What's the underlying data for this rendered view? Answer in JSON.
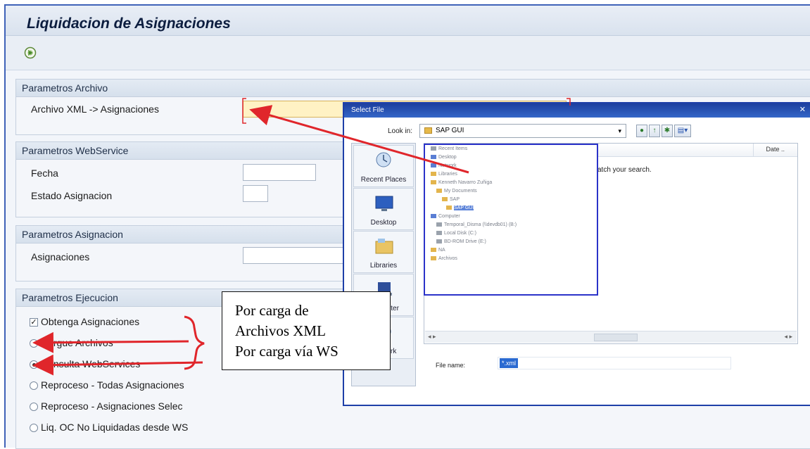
{
  "window": {
    "title": "Liquidacion de Asignaciones"
  },
  "toolbar": {
    "execute_icon": "execute-icon"
  },
  "groups": {
    "archivo": {
      "title": "Parametros Archivo",
      "field_label": "Archivo XML -> Asignaciones",
      "field_value": ""
    },
    "webservice": {
      "title": "Parametros WebService",
      "fecha_label": "Fecha",
      "fecha_value": "",
      "estado_label": "Estado Asignacion",
      "estado_value": ""
    },
    "asignacion": {
      "title": "Parametros Asignacion",
      "asignaciones_label": "Asignaciones",
      "asignaciones_value": ""
    },
    "ejecucion": {
      "title": "Parametros Ejecucion",
      "checkbox_label": "Obtenga Asignaciones",
      "checkbox_checked": true,
      "options": [
        {
          "label": "Cargue Archivos",
          "selected": false
        },
        {
          "label": "Consulta WebServices",
          "selected": true
        },
        {
          "label": "Reproceso - Todas Asignaciones",
          "selected": false
        },
        {
          "label": "Reproceso - Asignaciones Selec",
          "selected": false
        },
        {
          "label": "Liq. OC No Liquidadas desde WS",
          "selected": false
        }
      ]
    }
  },
  "dialog": {
    "title": "Select File",
    "look_in_label": "Look in:",
    "look_in_value": "SAP GUI",
    "places": [
      {
        "label": "Recent Places",
        "icon": "recent-places-icon"
      },
      {
        "label": "Desktop",
        "icon": "desktop-icon"
      },
      {
        "label": "Libraries",
        "icon": "libraries-icon"
      },
      {
        "label": "Computer",
        "icon": "computer-icon"
      },
      {
        "label": "Network",
        "icon": "network-icon"
      }
    ],
    "column_date": "Date ..",
    "empty_message": "atch your search.",
    "file_name_label": "File name:",
    "file_name_value": "*.xml",
    "folder_tree": [
      "Recent Items",
      "Desktop",
      "Network",
      "Libraries",
      "Kenneth Navarro Zuñiga",
      "My Documents",
      "SAP",
      "SAP GUI",
      "Computer",
      "Temporal_Disma (\\\\devdb01) (B:)",
      "Local Disk (C:)",
      "BD-ROM Drive (E:)",
      "NA",
      "Archivos"
    ]
  },
  "callout": {
    "lines": [
      "Por carga de",
      "Archivos XML",
      "Por carga vía WS"
    ]
  },
  "colors": {
    "frame_border": "#3f62b8",
    "dialog_border": "#1e3fa8",
    "tree_highlight": "#2b33c9",
    "arrow": "#e0262b",
    "active_input": "#fff2c4"
  }
}
